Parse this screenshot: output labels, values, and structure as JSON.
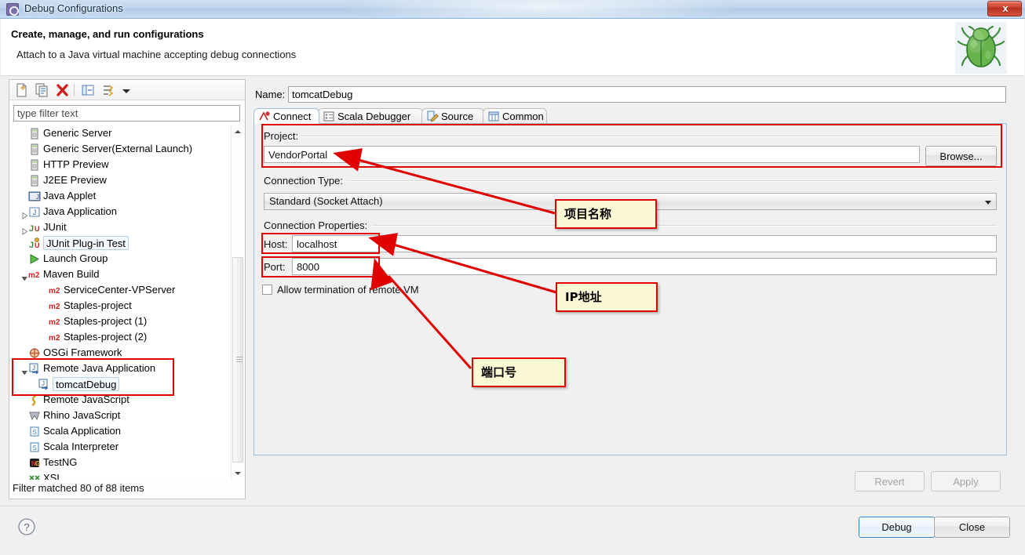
{
  "window": {
    "title": "Debug Configurations",
    "title_icon": "debug-config-icon",
    "close_label": "x"
  },
  "header": {
    "title": "Create, manage, and run configurations",
    "subtitle": "Attach to a Java virtual machine accepting debug connections",
    "icon": "green-bug-icon"
  },
  "toolbar": {
    "buttons": [
      {
        "name": "new-configuration",
        "icon": "new-document-icon"
      },
      {
        "name": "duplicate-configuration",
        "icon": "copy-icon"
      },
      {
        "name": "delete-configuration",
        "icon": "red-x-delete-icon"
      },
      {
        "name": "collapse-all",
        "icon": "collapse-all-icon"
      },
      {
        "name": "filter-menu",
        "icon": "filter-icon"
      },
      {
        "name": "filter-dropdown-arrow",
        "icon": "chevron-down-icon"
      }
    ]
  },
  "filter": {
    "placeholder": "type filter text",
    "value": "",
    "status": "Filter matched 80 of 88 items"
  },
  "tree": {
    "items": [
      {
        "label": "Generic Server",
        "icon": "server-icon",
        "indent": 36,
        "twisty": "none",
        "selected": false
      },
      {
        "label": "Generic Server(External Launch)",
        "icon": "server-icon",
        "indent": 36,
        "twisty": "none",
        "selected": false
      },
      {
        "label": "HTTP Preview",
        "icon": "server-icon",
        "indent": 36,
        "twisty": "none",
        "selected": false
      },
      {
        "label": "J2EE Preview",
        "icon": "server-icon",
        "indent": 36,
        "twisty": "none",
        "selected": false
      },
      {
        "label": "Java Applet",
        "icon": "java-applet-icon",
        "indent": 36,
        "twisty": "none",
        "selected": false
      },
      {
        "label": "Java Application",
        "icon": "java-application-icon",
        "indent": 36,
        "twisty": "collapsed",
        "selected": false
      },
      {
        "label": "JUnit",
        "icon": "junit-icon",
        "indent": 36,
        "twisty": "collapsed",
        "selected": false
      },
      {
        "label": "JUnit Plug-in Test",
        "icon": "junit-plugin-icon",
        "indent": 36,
        "twisty": "none",
        "selected": true
      },
      {
        "label": "Launch Group",
        "icon": "launch-group-icon",
        "indent": 36,
        "twisty": "none",
        "selected": false
      },
      {
        "label": "Maven Build",
        "icon": "maven-icon",
        "indent": 36,
        "twisty": "expanded",
        "selected": false
      },
      {
        "label": "ServiceCenter-VPServer",
        "icon": "maven-icon",
        "indent": 62,
        "twisty": "none",
        "selected": false
      },
      {
        "label": "Staples-project",
        "icon": "maven-icon",
        "indent": 62,
        "twisty": "none",
        "selected": false
      },
      {
        "label": "Staples-project (1)",
        "icon": "maven-icon",
        "indent": 62,
        "twisty": "none",
        "selected": false
      },
      {
        "label": "Staples-project (2)",
        "icon": "maven-icon",
        "indent": 62,
        "twisty": "none",
        "selected": false
      },
      {
        "label": "OSGi Framework",
        "icon": "osgi-icon",
        "indent": 36,
        "twisty": "none",
        "selected": false
      },
      {
        "label": "Remote Java Application",
        "icon": "remote-java-icon",
        "indent": 36,
        "twisty": "expanded",
        "selected": false
      },
      {
        "label": "tomcatDebug",
        "icon": "remote-java-icon",
        "indent": 48,
        "twisty": "none",
        "selected": true
      },
      {
        "label": "Remote JavaScript",
        "icon": "remote-js-icon",
        "indent": 36,
        "twisty": "none",
        "selected": false
      },
      {
        "label": "Rhino JavaScript",
        "icon": "rhino-icon",
        "indent": 36,
        "twisty": "none",
        "selected": false
      },
      {
        "label": "Scala Application",
        "icon": "scala-icon",
        "indent": 36,
        "twisty": "none",
        "selected": false
      },
      {
        "label": "Scala Interpreter",
        "icon": "scala-icon",
        "indent": 36,
        "twisty": "none",
        "selected": false
      },
      {
        "label": "TestNG",
        "icon": "testng-icon",
        "indent": 36,
        "twisty": "none",
        "selected": false
      },
      {
        "label": "XSL",
        "icon": "xsl-icon",
        "indent": 36,
        "twisty": "none",
        "selected": false
      }
    ]
  },
  "config": {
    "name_label": "Name:",
    "name_value": "tomcatDebug",
    "tabs": [
      {
        "label": "Connect",
        "icon": "connect-icon",
        "active": true
      },
      {
        "label": "Scala Debugger",
        "icon": "scala-debugger-icon",
        "active": false
      },
      {
        "label": "Source",
        "icon": "source-icon",
        "active": false
      },
      {
        "label": "Common",
        "icon": "common-icon",
        "active": false
      }
    ],
    "project": {
      "group_label": "Project:",
      "value": "VendorPortal",
      "browse_label": "Browse..."
    },
    "connection_type": {
      "group_label": "Connection Type:",
      "selected": "Standard (Socket Attach)"
    },
    "connection_properties": {
      "group_label": "Connection Properties:",
      "host_label": "Host:",
      "host_value": "localhost",
      "port_label": "Port:",
      "port_value": "8000"
    },
    "allow_termination": {
      "label": "Allow termination of remote VM",
      "checked": false
    }
  },
  "buttons": {
    "revert": "Revert",
    "revert_enabled": false,
    "apply": "Apply",
    "apply_enabled": false,
    "debug": "Debug",
    "close": "Close",
    "help_icon": "help-question-icon"
  },
  "annotations": {
    "callouts": [
      {
        "text": "项目名称",
        "name": "callout-project-name"
      },
      {
        "text": "IP地址",
        "name": "callout-ip-address"
      },
      {
        "text": "端口号",
        "name": "callout-port-number"
      }
    ],
    "accent_color": "#e00000",
    "box_fill": "#fbf8d4"
  }
}
